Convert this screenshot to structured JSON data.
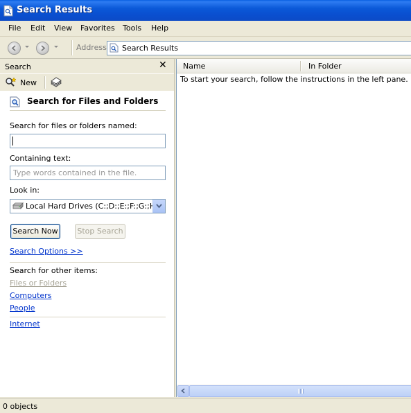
{
  "window": {
    "title": "Search Results",
    "icon": "search-results-icon"
  },
  "menu": [
    "File",
    "Edit",
    "View",
    "Favorites",
    "Tools",
    "Help"
  ],
  "address": {
    "label": "Address",
    "value": "Search Results"
  },
  "search_pane": {
    "header": "Search",
    "close_glyph": "✕",
    "new_label": "New",
    "title": "Search for Files and Folders",
    "name_label": "Search for files or folders named:",
    "name_value": "",
    "containing_label": "Containing text:",
    "containing_placeholder": "Type words contained in the file.",
    "lookin_label": "Look in:",
    "lookin_value": "Local Hard Drives (C:;D:;E:;F:;G:;H:)",
    "search_now": "Search Now",
    "stop_search": "Stop Search",
    "search_options": "Search Options >>",
    "other_items_label": "Search for other items:",
    "other_items": [
      "Files or Folders",
      "Computers",
      "People"
    ],
    "internet": "Internet"
  },
  "results": {
    "columns": [
      "Name",
      "In Folder"
    ],
    "empty_message": "To start your search, follow the instructions in the left pane."
  },
  "status": {
    "text": "0 objects"
  },
  "colors": {
    "titlebar": "#0b59d8",
    "chrome": "#ece9d8",
    "link": "#0033cc"
  }
}
